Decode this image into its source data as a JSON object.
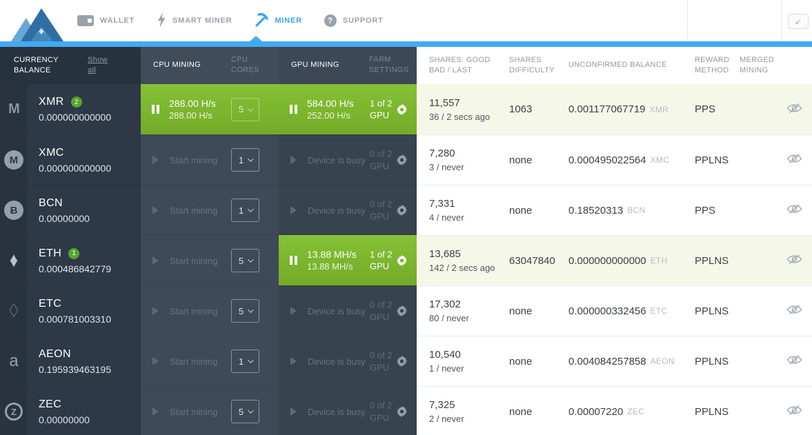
{
  "app": {
    "accent_blue": "#42aaf2",
    "active_green": "#7cb52e",
    "highlight_row_bg": "#f5f8e9"
  },
  "topnav": {
    "items": [
      {
        "label": "WALLET",
        "icon": "wallet-icon",
        "active": false
      },
      {
        "label": "SMART MINER",
        "icon": "lightning-icon",
        "active": false
      },
      {
        "label": "MINER",
        "icon": "pickaxe-icon",
        "active": true
      },
      {
        "label": "SUPPORT",
        "icon": "question-icon",
        "active": false
      }
    ],
    "collapse_icon": "↙"
  },
  "table_header": {
    "currency_balance": "CURRENCY BALANCE",
    "show_all": "Show all",
    "cpu_mining": "CPU MINING",
    "cpu_cores": "CPU CORES",
    "gpu_mining": "GPU MINING",
    "farm_settings": "FARM SETTINGS",
    "shares": "SHARES: GOOD BAD / LAST",
    "shares_difficulty": "SHARES DIFFICULTY",
    "unconfirmed_balance": "UNCONFIRMED BALANCE",
    "reward_method": "REWARD METHOD",
    "merged_mining": "MERGED MINING"
  },
  "rows": [
    {
      "currency": "XMR",
      "badge": "2",
      "balance": "0.000000000000",
      "icon": {
        "style": "xmr",
        "glyph": "M"
      },
      "cpu": {
        "active": true,
        "hashrate": "288.00 H/s",
        "hashrate_current": "288.00 H/s",
        "cores": "5"
      },
      "gpu": {
        "active": true,
        "hashrate": "584.00 H/s",
        "hashrate_current": "252.00 H/s",
        "devices": "1 of 2",
        "devices_unit": "GPU"
      },
      "shares_good": "11,557",
      "shares_detail": "36 / 2 secs ago",
      "difficulty": "1063",
      "unconfirmed_amount": "0.001177067719",
      "unconfirmed_currency": "XMR",
      "reward_method": "PPS",
      "highlighted": true
    },
    {
      "currency": "XMC",
      "badge": "",
      "balance": "0.000000000000",
      "icon": {
        "style": "circle-m",
        "glyph": "M"
      },
      "cpu": {
        "active": false,
        "idle_label": "Start mining",
        "cores": "1"
      },
      "gpu": {
        "active": false,
        "idle_label": "Device is busy",
        "devices": "0 of 2",
        "devices_unit": "GPU"
      },
      "shares_good": "7,280",
      "shares_detail": "3 / never",
      "difficulty": "none",
      "unconfirmed_amount": "0.000495022564",
      "unconfirmed_currency": "XMC",
      "reward_method": "PPLNS",
      "highlighted": false
    },
    {
      "currency": "BCN",
      "badge": "",
      "balance": "0.00000000",
      "icon": {
        "style": "circle-b",
        "glyph": "Ƀ"
      },
      "cpu": {
        "active": false,
        "idle_label": "Start mining",
        "cores": "1"
      },
      "gpu": {
        "active": false,
        "idle_label": "Device is busy",
        "devices": "0 of 2",
        "devices_unit": "GPU"
      },
      "shares_good": "7,331",
      "shares_detail": "4 / never",
      "difficulty": "none",
      "unconfirmed_amount": "0.18520313",
      "unconfirmed_currency": "BCN",
      "reward_method": "PPS",
      "highlighted": false
    },
    {
      "currency": "ETH",
      "badge": "1",
      "balance": "0.000486842779",
      "icon": {
        "style": "eth",
        "glyph": "♦"
      },
      "cpu": {
        "active": false,
        "idle_label": "Start mining",
        "cores": "5"
      },
      "gpu": {
        "active": true,
        "hashrate": "13.88 MH/s",
        "hashrate_current": "13.88 MH/s",
        "devices": "1 of 2",
        "devices_unit": "GPU"
      },
      "shares_good": "13,685",
      "shares_detail": "142 / 2 secs ago",
      "difficulty": "63047840",
      "unconfirmed_amount": "0.000000000000",
      "unconfirmed_currency": "ETH",
      "reward_method": "PPLNS",
      "highlighted": true
    },
    {
      "currency": "ETC",
      "badge": "",
      "balance": "0.000781003310",
      "icon": {
        "style": "etc",
        "glyph": "♢"
      },
      "cpu": {
        "active": false,
        "idle_label": "Start mining",
        "cores": "5"
      },
      "gpu": {
        "active": false,
        "idle_label": "Device is busy",
        "devices": "0 of 2",
        "devices_unit": "GPU"
      },
      "shares_good": "17,302",
      "shares_detail": "80 / never",
      "difficulty": "none",
      "unconfirmed_amount": "0.000000332456",
      "unconfirmed_currency": "ETC",
      "reward_method": "PPLNS",
      "highlighted": false
    },
    {
      "currency": "AEON",
      "badge": "",
      "balance": "0.195939463195",
      "icon": {
        "style": "aeon",
        "glyph": "a"
      },
      "cpu": {
        "active": false,
        "idle_label": "Start mining",
        "cores": "1"
      },
      "gpu": {
        "active": false,
        "idle_label": "Device is busy",
        "devices": "0 of 2",
        "devices_unit": "GPU"
      },
      "shares_good": "10,540",
      "shares_detail": "1 / never",
      "difficulty": "none",
      "unconfirmed_amount": "0.004084257858",
      "unconfirmed_currency": "AEON",
      "reward_method": "PPLNS",
      "highlighted": false
    },
    {
      "currency": "ZEC",
      "badge": "",
      "balance": "0.00000000",
      "icon": {
        "style": "zec",
        "glyph": "Z"
      },
      "cpu": {
        "active": false,
        "idle_label": "Start mining",
        "cores": "5"
      },
      "gpu": {
        "active": false,
        "idle_label": "Device is busy",
        "devices": "0 of 2",
        "devices_unit": "GPU"
      },
      "shares_good": "7,325",
      "shares_detail": "2 / never",
      "difficulty": "none",
      "unconfirmed_amount": "0.00007220",
      "unconfirmed_currency": "ZEC",
      "reward_method": "PPLNS",
      "highlighted": false
    }
  ]
}
